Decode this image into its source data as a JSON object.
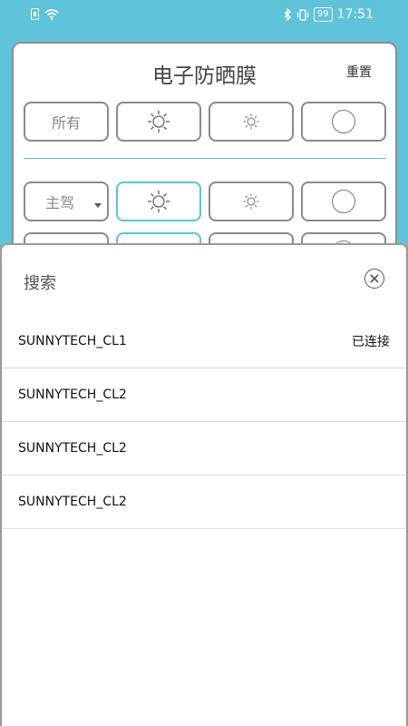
{
  "status_bar": {
    "battery": "99",
    "time": "17:51"
  },
  "panel": {
    "title": "电子防晒膜",
    "reset_label": "重置",
    "row1": {
      "all_label": "所有"
    },
    "row2": {
      "seat_label": "主驾"
    }
  },
  "search_sheet": {
    "title": "搜索",
    "devices": [
      {
        "name": "SUNNYTECH_CL1",
        "status": "已连接"
      },
      {
        "name": "SUNNYTECH_CL2",
        "status": ""
      },
      {
        "name": "SUNNYTECH_CL2",
        "status": ""
      },
      {
        "name": "SUNNYTECH_CL2",
        "status": ""
      }
    ]
  },
  "colors": {
    "accent": "#5fc3d9",
    "active_border": "#56c6d6",
    "button_border": "#8a8a8a"
  }
}
